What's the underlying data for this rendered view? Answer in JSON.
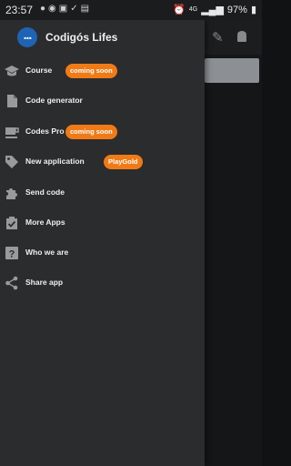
{
  "statusbar": {
    "time": "23:57",
    "network": "4G",
    "battery": "97%"
  },
  "drawer": {
    "app_title": "Codigós Lifes",
    "items": [
      {
        "label": "Course",
        "badge": "coming soon",
        "icon": "graduation-cap-icon"
      },
      {
        "label": "Code generator",
        "icon": "file-icon"
      },
      {
        "label": "Codes Pro",
        "badge": "coming soon",
        "icon": "coffee-icon"
      },
      {
        "label": "New application",
        "badge": "PlayGold",
        "icon": "tag-icon"
      },
      {
        "label": "Send code",
        "icon": "puzzle-icon"
      },
      {
        "label": "More Apps",
        "icon": "clipboard-check-icon"
      },
      {
        "label": "Who we are",
        "icon": "help-icon"
      },
      {
        "label": "Share app",
        "icon": "share-icon"
      }
    ]
  },
  "colors": {
    "accent": "#f07b16",
    "drawer_bg": "#2b2c2e",
    "avatar": "#1f63b4"
  }
}
